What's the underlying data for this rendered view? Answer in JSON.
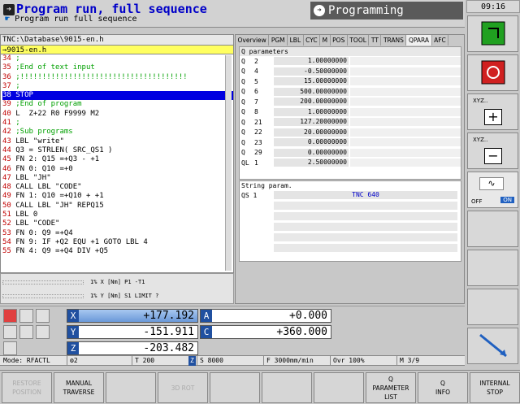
{
  "header": {
    "mode_primary": "Program run, full sequence",
    "mode_secondary": "Program run full sequence",
    "programming": "Programming",
    "clock": "09:16"
  },
  "editor": {
    "path": "TNC:\\Database\\9015-en.h",
    "file": "→9015-en.h",
    "lines": [
      {
        "n": "34",
        "t": " ;",
        "kind": "cmt"
      },
      {
        "n": "35",
        "t": " ;End of text input",
        "kind": "cmt"
      },
      {
        "n": "36",
        "t": " ;!!!!!!!!!!!!!!!!!!!!!!!!!!!!!!!!!!!!!!",
        "kind": "cmt"
      },
      {
        "n": "37",
        "t": " ;",
        "kind": "cmt"
      },
      {
        "n": "38",
        "t": " STOP",
        "kind": "sel"
      },
      {
        "n": "39",
        "t": " ;End of program",
        "kind": "cmt"
      },
      {
        "n": "40",
        "t": " L  Z+22 R0 F9999 M2",
        "kind": "plain"
      },
      {
        "n": "41",
        "t": " ;",
        "kind": "cmt"
      },
      {
        "n": "42",
        "t": " ;Sub programs",
        "kind": "cmt"
      },
      {
        "n": "43",
        "t": " LBL \"write\"",
        "kind": "plain"
      },
      {
        "n": "44",
        "t": " Q3 = STRLEN( SRC_QS1 )",
        "kind": "plain"
      },
      {
        "n": "45",
        "t": " FN 2: Q15 =+Q3 - +1",
        "kind": "plain"
      },
      {
        "n": "46",
        "t": " FN 0: Q10 =+0",
        "kind": "plain"
      },
      {
        "n": "47",
        "t": " LBL \"JH\"",
        "kind": "plain"
      },
      {
        "n": "48",
        "t": " CALL LBL \"CODE\"",
        "kind": "plain"
      },
      {
        "n": "49",
        "t": " FN 1: Q10 =+Q10 + +1",
        "kind": "plain"
      },
      {
        "n": "50",
        "t": " CALL LBL \"JH\" REPQ15",
        "kind": "plain"
      },
      {
        "n": "51",
        "t": " LBL 0",
        "kind": "plain"
      },
      {
        "n": "52",
        "t": " LBL \"CODE\"",
        "kind": "plain"
      },
      {
        "n": "53",
        "t": " FN 0: Q9 =+Q4",
        "kind": "plain"
      },
      {
        "n": "54",
        "t": " FN 9: IF +Q2 EQU +1 GOTO LBL 4",
        "kind": "plain"
      },
      {
        "n": "55",
        "t": " FN 4: Q9 =+Q4 DIV +Q5",
        "kind": "plain"
      }
    ]
  },
  "status_left": {
    "row1": "1% X [Nm]  P1  -T1",
    "row2": "1% Y [Nm]  S1  LIMIT ?"
  },
  "tabs": [
    "Overview",
    "PGM",
    "LBL",
    "CYC",
    "M",
    "POS",
    "TOOL",
    "TT",
    "TRANS",
    "QPARA",
    "AFC"
  ],
  "active_tab": "QPARA",
  "q_params": {
    "title": "Q parameters",
    "rows": [
      {
        "k": "Q",
        "i": "2",
        "v": "1.00000000"
      },
      {
        "k": "Q",
        "i": "4",
        "v": "-0.50000000"
      },
      {
        "k": "Q",
        "i": "5",
        "v": "15.00000000"
      },
      {
        "k": "Q",
        "i": "6",
        "v": "500.00000000"
      },
      {
        "k": "Q",
        "i": "7",
        "v": "200.00000000"
      },
      {
        "k": "Q",
        "i": "8",
        "v": "1.00000000"
      },
      {
        "k": "Q",
        "i": "21",
        "v": "127.20000000"
      },
      {
        "k": "Q",
        "i": "22",
        "v": "20.00000000"
      },
      {
        "k": "Q",
        "i": "23",
        "v": "0.00000000"
      },
      {
        "k": "Q",
        "i": "29",
        "v": "0.00000000"
      },
      {
        "k": "QL",
        "i": "1",
        "v": "2.50000000"
      }
    ]
  },
  "string_params": {
    "title": "String param.",
    "key": "QS 1",
    "value": "TNC 640"
  },
  "positions": {
    "X": "+177.192",
    "Y": "-151.911",
    "Z": "-203.482",
    "A": "+0.000",
    "C": "+360.000"
  },
  "info": {
    "mode": "Mode: RFACTL",
    "tool_icon_val": "2",
    "T": "T 200",
    "Z": "Z",
    "S": "S 8000",
    "F": "F 3000mm/min",
    "ovr": "Ovr 100%",
    "M": "M 3/9"
  },
  "right_softkeys": {
    "xyz_plus": "XYZ..",
    "xyz_minus": "XYZ..",
    "off": "OFF",
    "on": "ON"
  },
  "bottom_softkeys": [
    {
      "label": "RESTORE\nPOSITION",
      "disabled": true
    },
    {
      "label": "MANUAL\nTRAVERSE",
      "disabled": false
    },
    {
      "label": "",
      "disabled": false
    },
    {
      "label": "3D ROT",
      "disabled": true
    },
    {
      "label": "",
      "disabled": false
    },
    {
      "label": "",
      "disabled": false
    },
    {
      "label": "",
      "disabled": false
    },
    {
      "label": "Q\nPARAMETER\nLIST",
      "disabled": false
    },
    {
      "label": "Q\nINFO",
      "disabled": false
    },
    {
      "label": "INTERNAL\nSTOP",
      "disabled": false
    }
  ]
}
